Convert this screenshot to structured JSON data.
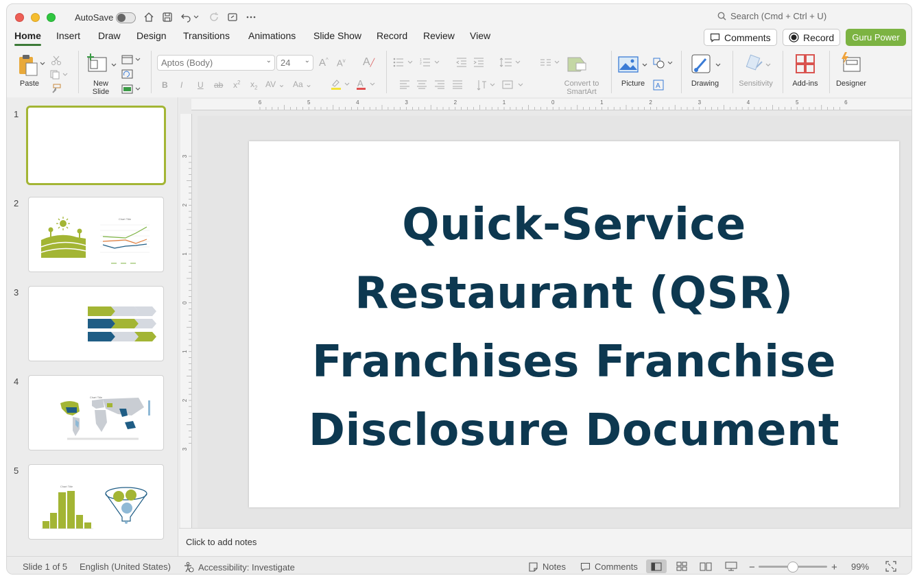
{
  "titlebar": {
    "autosave_label": "AutoSave",
    "search_placeholder": "Search (Cmd + Ctrl + U)"
  },
  "tabs": [
    "Home",
    "Insert",
    "Draw",
    "Design",
    "Transitions",
    "Animations",
    "Slide Show",
    "Record",
    "Review",
    "View"
  ],
  "active_tab": "Home",
  "header_buttons": {
    "comments": "Comments",
    "record": "Record",
    "addon": "Guru Power"
  },
  "ribbon": {
    "paste": "Paste",
    "new_slide_line1": "New",
    "new_slide_line2": "Slide",
    "font_name": "Aptos (Body)",
    "font_size": "24",
    "convert_line1": "Convert to",
    "convert_line2": "SmartArt",
    "picture": "Picture",
    "drawing": "Drawing",
    "sensitivity": "Sensitivity",
    "addins": "Add-ins",
    "designer": "Designer"
  },
  "thumbnails": {
    "numbers": [
      "1",
      "2",
      "3",
      "4",
      "5"
    ],
    "chart_title_small": "Chart Title"
  },
  "slide": {
    "title_lines": [
      "Quick-Service",
      "Restaurant (QSR)",
      "Franchises Franchise",
      "Disclosure Document"
    ]
  },
  "rulers": {
    "h_ticks": [
      "6",
      "5",
      "4",
      "3",
      "2",
      "1",
      "0",
      "1",
      "2",
      "3",
      "4",
      "5",
      "6"
    ],
    "v_ticks": [
      "3",
      "2",
      "1",
      "0",
      "1",
      "2",
      "3"
    ]
  },
  "notes_placeholder": "Click to add notes",
  "status": {
    "slide_position": "Slide 1 of 5",
    "language": "English (United States)",
    "accessibility": "Accessibility: Investigate",
    "notes": "Notes",
    "comments": "Comments",
    "zoom": "99%"
  },
  "colors": {
    "title_text": "#0d3850",
    "accent_green": "#a3b534",
    "accent_blue": "#1f5d85",
    "brand_button": "#7cb342"
  }
}
